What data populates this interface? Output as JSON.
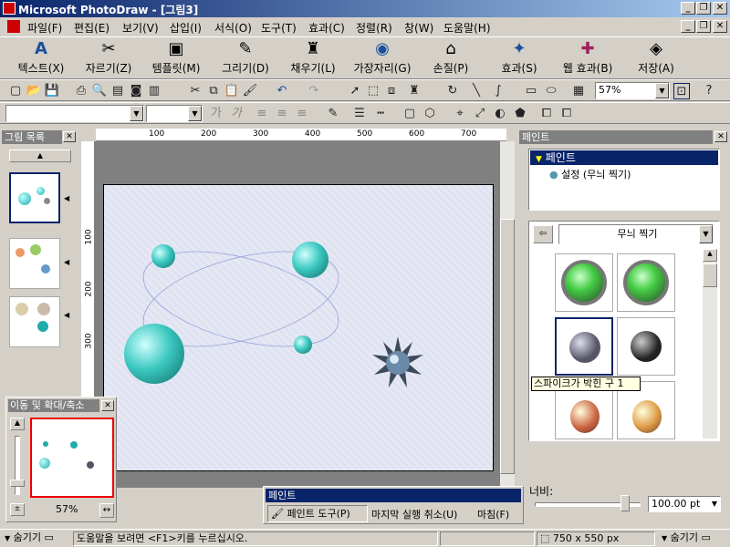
{
  "window": {
    "title": "Microsoft PhotoDraw - [그림3]"
  },
  "menu": [
    "파일(F)",
    "편집(E)",
    "보기(V)",
    "삽입(I)",
    "서식(O)",
    "도구(T)",
    "효과(C)",
    "정렬(R)",
    "창(W)",
    "도움말(H)"
  ],
  "visual_menu": [
    "텍스트(X)",
    "자르기(Z)",
    "템플릿(M)",
    "그리기(D)",
    "채우기(L)",
    "가장자리(G)",
    "손질(P)",
    "효과(S)",
    "웹 효과(B)",
    "저장(A)"
  ],
  "toolbar": {
    "zoom_value": "57%"
  },
  "left_panel": {
    "title": "그림 목록",
    "scroll_up": "▲"
  },
  "pan_zoom": {
    "title": "이동 및 확대/축소",
    "zoom_percent": "57%"
  },
  "ruler": {
    "h_ticks": [
      "100",
      "200",
      "300",
      "400",
      "500",
      "600",
      "700"
    ],
    "v_ticks": [
      "100",
      "200",
      "300"
    ]
  },
  "right_panel": {
    "title": "페인트",
    "tree_header": "페인트",
    "tree_item": "설정 (무늬 찍기)",
    "category": "무늬 찍기",
    "tooltip": "스파이크가 박힌 구 1"
  },
  "paint_toolbar": {
    "title": "페인트",
    "paint_tool": "페인트 도구(P)",
    "undo_last": "마지막 실행 취소(U)",
    "finish": "마침(F)"
  },
  "width_control": {
    "label": "너비:",
    "value": "100.00 pt"
  },
  "status": {
    "hide_left": "숨기기",
    "help_text": "도움말을 보려면 <F1>키를 누르십시오.",
    "dimensions": "750 x 550 px",
    "hide_right": "숨기기"
  },
  "colors": {
    "titlebar_start": "#0a246a",
    "titlebar_end": "#a6caf0",
    "selection": "#0a246a",
    "ball": "#3cc8c0"
  }
}
